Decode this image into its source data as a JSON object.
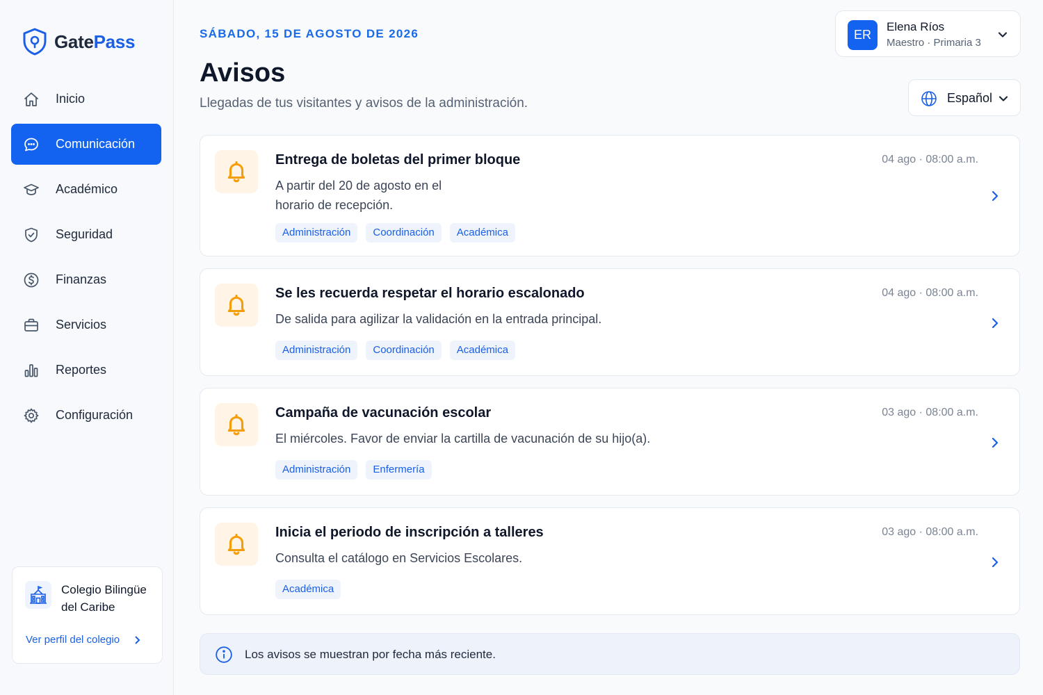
{
  "brand": {
    "name_part1": "Gate",
    "name_part2": "Pass"
  },
  "nav": {
    "items": [
      {
        "label": "Inicio",
        "icon": "home-icon"
      },
      {
        "label": "Comunicación",
        "icon": "chat-icon",
        "active": true
      },
      {
        "label": "Académico",
        "icon": "graduation-cap-icon"
      },
      {
        "label": "Seguridad",
        "icon": "shield-check-icon"
      },
      {
        "label": "Finanzas",
        "icon": "dollar-circle-icon"
      },
      {
        "label": "Servicios",
        "icon": "briefcase-icon"
      },
      {
        "label": "Reportes",
        "icon": "bar-chart-icon"
      },
      {
        "label": "Configuración",
        "icon": "gear-icon"
      }
    ]
  },
  "school": {
    "name": "Colegio Bilingüe del Caribe",
    "link": "Ver perfil del colegio"
  },
  "header": {
    "date": "SÁBADO, 15 DE AGOSTO DE 2026",
    "title": "Avisos",
    "subtitle": "Llegadas de tus visitantes y avisos de la administración."
  },
  "user": {
    "initials": "ER",
    "name": "Elena Ríos",
    "role": "Maestro · Primaria 3"
  },
  "language": {
    "selected": "Español"
  },
  "notices": [
    {
      "title": "Entrega de boletas del primer bloque",
      "body": "A partir del 20 de agosto en el horario de recepción.",
      "time": "04 ago · 08:00 a.m.",
      "tags": [
        "Administración",
        "Coordinación",
        "Académica"
      ]
    },
    {
      "title": "Se les recuerda respetar el horario escalonado",
      "body": "De salida para agilizar la validación en la entrada principal.",
      "time": "04 ago · 08:00 a.m.",
      "tags": [
        "Administración",
        "Coordinación",
        "Académica"
      ]
    },
    {
      "title": "Campaña de vacunación escolar",
      "body": "El miércoles. Favor de enviar la cartilla de vacunación de su hijo(a).",
      "time": "03 ago · 08:00 a.m.",
      "tags": [
        "Administración",
        "Enfermería"
      ]
    },
    {
      "title": "Inicia el periodo de inscripción a talleres",
      "body": "Consulta el catálogo en Servicios Escolares.",
      "time": "03 ago · 08:00 a.m.",
      "tags": [
        "Académica"
      ]
    }
  ],
  "info": {
    "text": "Los avisos se muestran por fecha más reciente."
  },
  "colors": {
    "accent": "#1463f0",
    "bell": "#f59e0b",
    "tag_bg": "#eef3fc"
  }
}
